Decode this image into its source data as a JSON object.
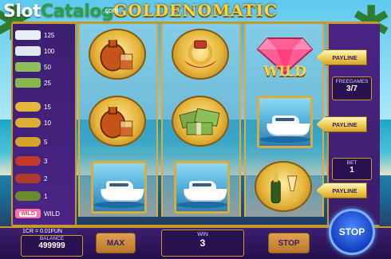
{
  "watermark": {
    "slot": "Slot",
    "catalog": "Catalog",
    "com": ".com"
  },
  "title": "GOLDENOMATIC",
  "paytable": {
    "rows": [
      {
        "value": "125",
        "icon": "yacht-icon",
        "color": "#e8f0f7"
      },
      {
        "value": "100",
        "icon": "yacht-icon",
        "color": "#dfe8f2"
      },
      {
        "value": "50",
        "icon": "cash-icon",
        "color": "#8fbf5a"
      },
      {
        "value": "25",
        "icon": "cash-icon",
        "color": "#86b652"
      },
      {
        "value": "15",
        "icon": "gold-coin-icon",
        "color": "#e6b63c"
      },
      {
        "value": "10",
        "icon": "gold-coin-icon",
        "color": "#dcae36"
      },
      {
        "value": "5",
        "icon": "gold-coin-icon",
        "color": "#d4a52a"
      },
      {
        "value": "3",
        "icon": "cognac-icon",
        "color": "#c0392b"
      },
      {
        "value": "2",
        "icon": "ring-icon",
        "color": "#b03a2e"
      },
      {
        "value": "1",
        "icon": "champagne-icon",
        "color": "#6c8b2f"
      }
    ],
    "wild_label": "WILD",
    "wild_badge": "WILD"
  },
  "reels": [
    [
      "cognac-icon",
      "cognac-icon",
      "yacht-icon"
    ],
    [
      "ring-icon",
      "cash-icon",
      "yacht-icon"
    ],
    [
      "diamond-wild-icon",
      "yacht-icon",
      "champagne-icon"
    ]
  ],
  "wild_symbol_label": "WILD",
  "paylines": [
    "PAYLINE",
    "PAYLINE",
    "PAYLINE"
  ],
  "freegames": {
    "label": "FREEGAMES",
    "value": "3/7"
  },
  "bet": {
    "label": "BET",
    "value": "1"
  },
  "credit_rate": "1CR = 0.01FUN",
  "balance": {
    "label": "BALANCE",
    "value": "499999"
  },
  "max_label": "MAX",
  "win": {
    "label": "WIN",
    "value": "3"
  },
  "stop_label": "STOP",
  "stop_big_label": "STOP",
  "colors": {
    "gold": "#c59a2b",
    "purple": "#3c1f70",
    "button": "#b9742a",
    "stop_blue": "#1a44c4"
  }
}
